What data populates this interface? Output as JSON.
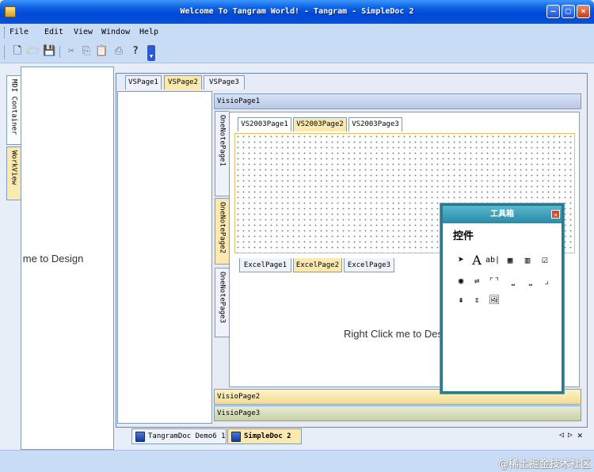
{
  "window": {
    "title": "Welcome To Tangram World! - Tangram - SimpleDoc 2",
    "min": "–",
    "max": "□",
    "close": "×"
  },
  "menu": [
    "File",
    "Edit",
    "View",
    "Window",
    "Help"
  ],
  "toolbar": {
    "icons": [
      "new-icon",
      "open-icon",
      "save-icon",
      "cut-icon",
      "copy-icon",
      "paste-icon",
      "print-icon",
      "help-icon"
    ],
    "overflow": "▼"
  },
  "left_tabs": [
    "MDI Container",
    "WorkView"
  ],
  "design_text": "Right Click me to Design",
  "vs_tabs": [
    "VSPage1",
    "VSPage2",
    "VSPage3"
  ],
  "visio_pages": [
    "VisioPage1",
    "VisioPage2",
    "VisioPage3"
  ],
  "onenote_tabs": [
    "OneNotePage1",
    "OneNotePage2",
    "OneNotePage3"
  ],
  "vs2003_tabs": [
    "VS2003Page1",
    "VS2003Page2",
    "VS2003Page3"
  ],
  "excel_tabs": [
    "ExcelPage1",
    "ExcelPage2",
    "ExcelPage3"
  ],
  "toolbox": {
    "title": "工具箱",
    "tab": "控件",
    "close": "×"
  },
  "doc_tabs": [
    "TangramDoc Demo6 1",
    "SimpleDoc 2"
  ],
  "doc_nav": {
    "prev": "◁",
    "next": "▷",
    "close": "✕"
  },
  "watermark": "@稀土掘金技术社区",
  "colors": {
    "active_tab": "#fbe9b0",
    "title_bar": "#0a5ee0",
    "toolbox_title": "#2b8aa6"
  }
}
